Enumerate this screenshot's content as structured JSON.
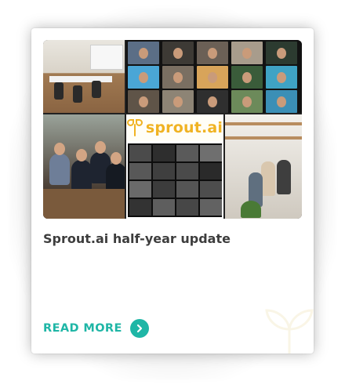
{
  "card": {
    "title": "Sprout.ai half-year update",
    "read_more_label": "READ MORE",
    "arrow_icon": "chevron-right-icon"
  },
  "collage": {
    "logo_text": "sprout.ai",
    "logo_icon": "sprout-logo-icon"
  },
  "colors": {
    "accent": "#1fb6a6",
    "logo": "#f0b323",
    "title_text": "#3d3d3d"
  }
}
